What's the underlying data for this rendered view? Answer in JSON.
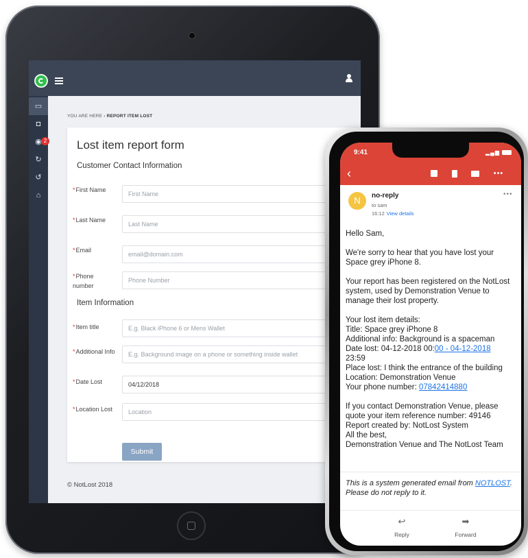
{
  "tablet": {
    "breadcrumb": {
      "prefix": "YOU ARE HERE",
      "separator": "›",
      "current": "REPORT ITEM LOST"
    },
    "sidebar": {
      "badge_count": "2"
    },
    "form": {
      "title": "Lost item report form",
      "contact_section": "Customer Contact Information",
      "item_section": "Item Information",
      "required_marker": "*",
      "fields": [
        {
          "label": "First Name",
          "placeholder": "First Name",
          "value": ""
        },
        {
          "label": "Last Name",
          "placeholder": "Last Name",
          "value": ""
        },
        {
          "label": "Email",
          "placeholder": "email@domain.com",
          "value": ""
        },
        {
          "label": "Phone number",
          "placeholder": "Phone Number",
          "value": ""
        },
        {
          "label": "Item title",
          "placeholder": "E.g. Black iPhone 6 or Mens Wallet",
          "value": ""
        },
        {
          "label": "Additional Info",
          "placeholder": "E.g. Background image on a phone or something inside wallet",
          "value": ""
        },
        {
          "label": "Date Lost",
          "placeholder": "",
          "value": "04/12/2018"
        },
        {
          "label": "Location Lost",
          "placeholder": "Location",
          "value": ""
        }
      ],
      "submit_label": "Submit"
    },
    "footer": "© NotLost 2018"
  },
  "phone": {
    "status_time": "9:41",
    "sender": {
      "avatar_letter": "N",
      "name": "no-reply",
      "to": "to sam",
      "time": "16:12",
      "view_details": "View details"
    },
    "body": {
      "greeting": "Hello Sam,",
      "p1": "We're sorry to hear that you have lost your Space grey iPhone 8.",
      "p2": "Your report has been registered on the NotLost system, used by Demonstration Venue to manage their lost property.",
      "details_heading": "Your lost item details:",
      "title_line": "Title: Space grey iPhone 8",
      "info_line": "Additional info: Background is a spaceman",
      "date_prefix": "Date lost: 04-12-2018 00:",
      "date_link": "00 - 04-12-2018",
      "date_suffix": "23:59",
      "place_line": "Place lost: I think the entrance of the building",
      "location_line": "Location: Demonstration Venue",
      "phone_prefix": "Your phone number: ",
      "phone_link": "07842414880",
      "p4": "If you contact Demonstration Venue, please quote your item reference number: 49146",
      "created_by": "Report created by: NotLost System",
      "sign_off": "All the best,",
      "team": "Demonstration Venue and The NotLost Team"
    },
    "footer": {
      "prefix": "This is a system generated email from ",
      "link": "NOTLOST",
      "suffix": ". Please do not reply to it."
    },
    "actions": {
      "reply": "Reply",
      "forward": "Forward"
    }
  },
  "colors": {
    "gmail_red": "#db4437",
    "nav_dark": "#3b4556",
    "brand_green": "#2fbf4a",
    "submit_blue": "#8aa4c4",
    "link_blue": "#1a73e8"
  }
}
